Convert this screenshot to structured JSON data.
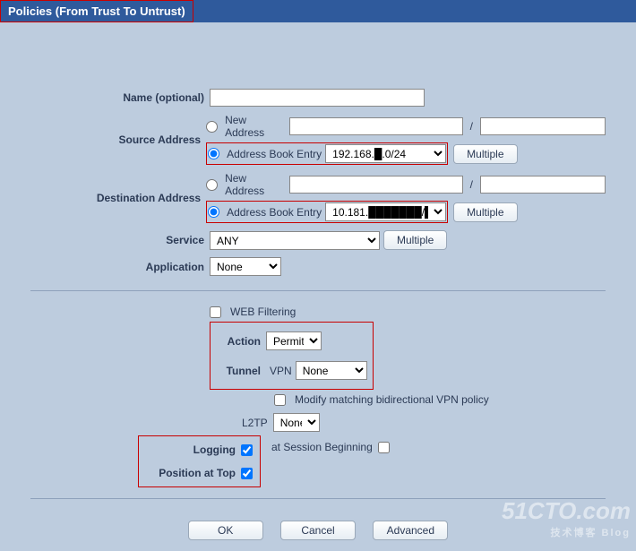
{
  "title": "Policies (From Trust To Untrust)",
  "labels": {
    "name": "Name (optional)",
    "src": "Source Address",
    "dst": "Destination Address",
    "service": "Service",
    "app": "Application",
    "webfilter": "WEB Filtering",
    "action": "Action",
    "tunnel": "Tunnel",
    "vpn": "VPN",
    "modify_bi": "Modify matching bidirectional VPN policy",
    "l2tp": "L2TP",
    "logging": "Logging",
    "at_session": "at Session Beginning",
    "pos_top": "Position at Top"
  },
  "addr_opts": {
    "new": "New Address",
    "book": "Address Book Entry",
    "slash": "/"
  },
  "buttons": {
    "multiple": "Multiple",
    "ok": "OK",
    "cancel": "Cancel",
    "advanced": "Advanced"
  },
  "values": {
    "name": "",
    "src_new_ip": "",
    "src_new_mask": "",
    "src_book": "192.168.█.0/24",
    "dst_new_ip": "",
    "dst_new_mask": "",
    "dst_book": "10.181.███████/██",
    "service": "ANY",
    "app": "None",
    "action": "Permit",
    "tunnel_vpn": "None",
    "l2tp": "None"
  },
  "state": {
    "src_mode": "book",
    "dst_mode": "book",
    "webfilter": false,
    "modify_bi": false,
    "logging": true,
    "at_session": false,
    "pos_top": true
  },
  "watermark": {
    "main": "51CTO.com",
    "sub": "技术博客  Blog"
  }
}
